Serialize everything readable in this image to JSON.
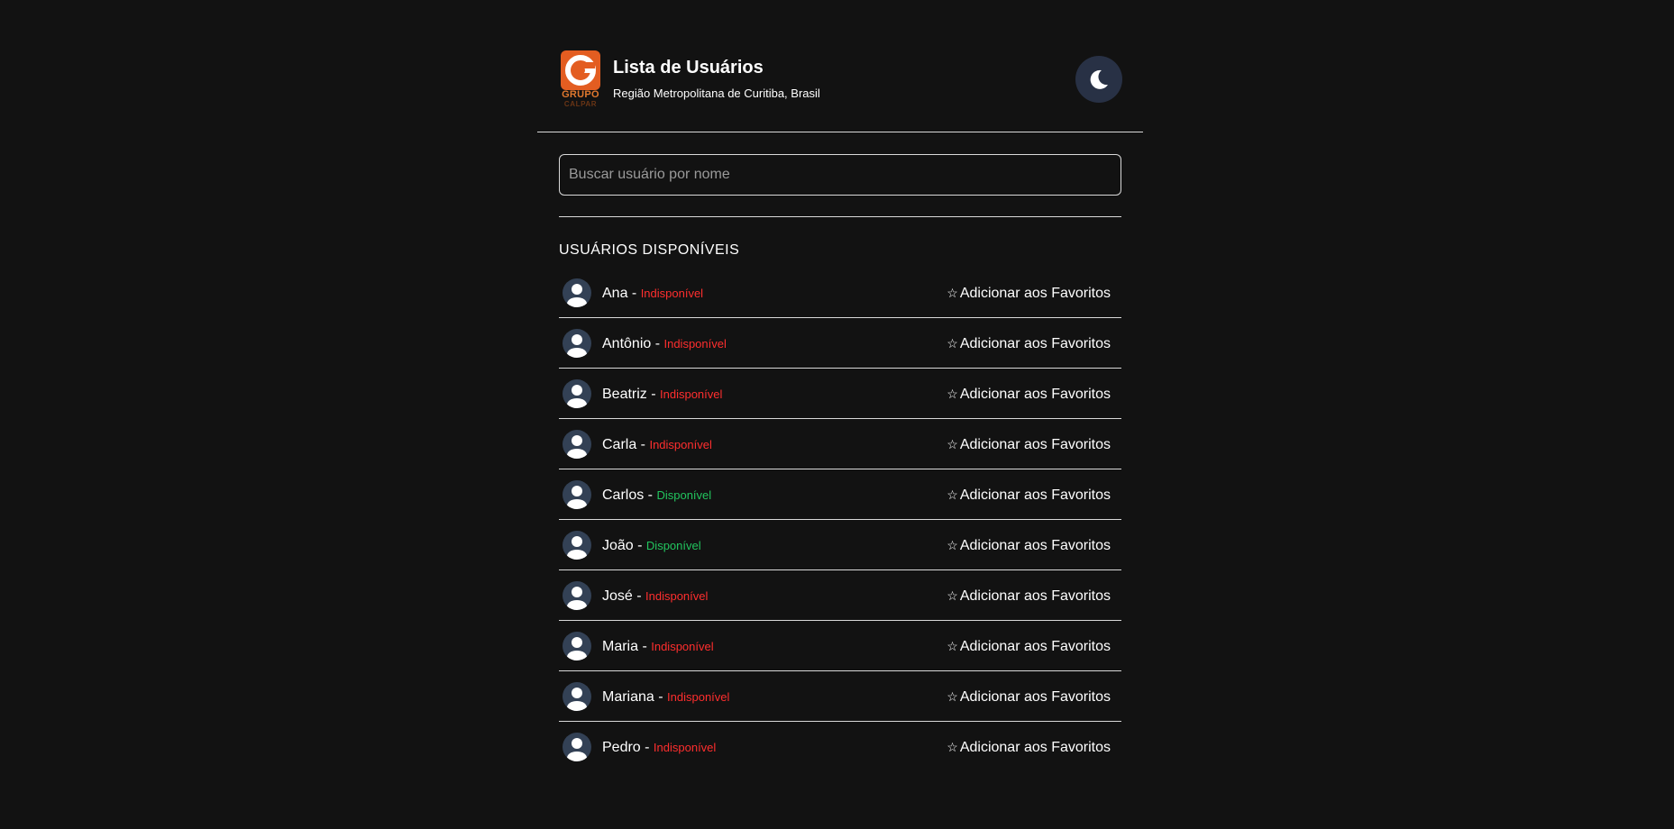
{
  "header": {
    "logo_line1": "GRUPO",
    "logo_line2": "CALPAR",
    "title": "Lista de Usuários",
    "subtitle": "Região Metropolitana de Curitiba, Brasil",
    "theme_icon": "moon-icon"
  },
  "search": {
    "placeholder": "Buscar usuário por nome",
    "value": ""
  },
  "section": {
    "title": "USUÁRIOS DISPONÍVEIS"
  },
  "colors": {
    "background": "#121212",
    "unavailable": "#ff2e2e",
    "available": "#22c55e",
    "avatar_bg": "#334155",
    "theme_button_bg": "#283145",
    "logo_orange": "#e35d21"
  },
  "users": [
    {
      "name": "Ana",
      "separator": " - ",
      "status": "Indisponível",
      "available": false,
      "action": "Adicionar aos Favoritos",
      "action_icon": "☆"
    },
    {
      "name": "Antônio",
      "separator": " - ",
      "status": "Indisponível",
      "available": false,
      "action": "Adicionar aos Favoritos",
      "action_icon": "☆"
    },
    {
      "name": "Beatriz",
      "separator": " - ",
      "status": "Indisponível",
      "available": false,
      "action": "Adicionar aos Favoritos",
      "action_icon": "☆"
    },
    {
      "name": "Carla",
      "separator": " - ",
      "status": "Indisponível",
      "available": false,
      "action": "Adicionar aos Favoritos",
      "action_icon": "☆"
    },
    {
      "name": "Carlos",
      "separator": " - ",
      "status": "Disponível",
      "available": true,
      "action": "Adicionar aos Favoritos",
      "action_icon": "☆"
    },
    {
      "name": "João",
      "separator": " - ",
      "status": "Disponível",
      "available": true,
      "action": "Adicionar aos Favoritos",
      "action_icon": "☆"
    },
    {
      "name": "José",
      "separator": " - ",
      "status": "Indisponível",
      "available": false,
      "action": "Adicionar aos Favoritos",
      "action_icon": "☆"
    },
    {
      "name": "Maria",
      "separator": " - ",
      "status": "Indisponível",
      "available": false,
      "action": "Adicionar aos Favoritos",
      "action_icon": "☆"
    },
    {
      "name": "Mariana",
      "separator": " - ",
      "status": "Indisponível",
      "available": false,
      "action": "Adicionar aos Favoritos",
      "action_icon": "☆"
    },
    {
      "name": "Pedro",
      "separator": " - ",
      "status": "Indisponível",
      "available": false,
      "action": "Adicionar aos Favoritos",
      "action_icon": "☆"
    }
  ]
}
